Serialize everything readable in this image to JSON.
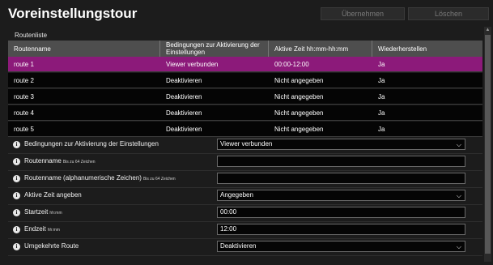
{
  "window": {
    "title": "Voreinstellungstour",
    "apply_label": "Übernehmen",
    "delete_label": "Löschen"
  },
  "routes": {
    "section_label": "Routenliste",
    "columns": [
      "Routenname",
      "Bedingungen zur Aktivierung der Einstellungen",
      "Aktive Zeit hh:mm-hh:mm",
      "Wiederherstellen"
    ],
    "rows": [
      {
        "name": "route  1",
        "condition": "Viewer verbunden",
        "active_time": "00:00-12:00",
        "restore": "Ja",
        "selected": true
      },
      {
        "name": "route  2",
        "condition": "Deaktivieren",
        "active_time": "Nicht angegeben",
        "restore": "Ja",
        "selected": false
      },
      {
        "name": "route  3",
        "condition": "Deaktivieren",
        "active_time": "Nicht angegeben",
        "restore": "Ja",
        "selected": false
      },
      {
        "name": "route  4",
        "condition": "Deaktivieren",
        "active_time": "Nicht angegeben",
        "restore": "Ja",
        "selected": false
      },
      {
        "name": "route  5",
        "condition": "Deaktivieren",
        "active_time": "Nicht angegeben",
        "restore": "Ja",
        "selected": false
      }
    ]
  },
  "form": {
    "activation_condition": {
      "label": "Bedingungen zur Aktivierung der Einstellungen",
      "value": "Viewer verbunden"
    },
    "route_name": {
      "label": "Routenname",
      "hint": "Bis zu 64 Zeichen",
      "value": ""
    },
    "route_name_alnum": {
      "label": "Routenname (alphanumerische Zeichen)",
      "hint": "Bis zu 64 Zeichen",
      "value": ""
    },
    "active_time": {
      "label": "Aktive Zeit angeben",
      "value": "Angegeben"
    },
    "start_time": {
      "label": "Startzeit",
      "hint": "hh:mm",
      "value": "00:00"
    },
    "end_time": {
      "label": "Endzeit",
      "hint": "hh:mm",
      "value": "12:00"
    },
    "reverse_route": {
      "label": "Umgekehrte Route",
      "value": "Deaktivieren"
    }
  },
  "icons": {
    "info": "info-icon",
    "chevron": "chevron-down-icon",
    "scroll_up": "scroll-up-arrow-icon"
  },
  "colors": {
    "selected_row": "#8c1a7a",
    "header_bg": "#4e4e4e",
    "background": "#1c1c1c"
  }
}
